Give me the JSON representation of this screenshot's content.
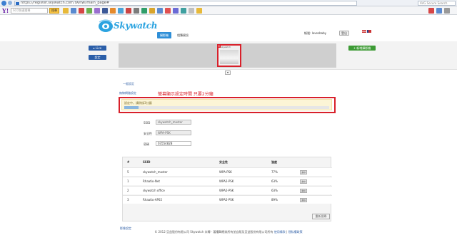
{
  "browser": {
    "url_prefix": "skywatch.com.tw",
    "url_full": "https://register.skywatch.com.tw/twi/main_page#",
    "search_placeholder": "AVG Secure Search"
  },
  "toolbar": {
    "search_placeholder": "SCO快速搜尋",
    "search_button": "搜尋"
  },
  "header": {
    "logo_text": "Skywatch",
    "tab_main": "攝影機",
    "tab_second": "相簿資訊",
    "account_label": "帳號: lovesbaby",
    "logout": "登出"
  },
  "camera": {
    "live_button": "▸ Live",
    "settings_button": "設定",
    "add_button": "+ 新增攝影機",
    "thumb_caption": "skywatch",
    "scroll_icon": "▾"
  },
  "settings": {
    "section_general": "一般設定",
    "section_wireless": "無線網路設定",
    "annotation": "螢幕顯示設定時間 只要2分鐘",
    "alert_text": "設定中，請稍候3分鐘",
    "alert_progress": 0.07,
    "ssid_label": "SSID",
    "ssid_value": "skywatch_master",
    "security_label": "安全性",
    "security_value": "WPA-PSK",
    "password_label": "密碼",
    "password_value": "03554828",
    "table_headers": [
      "#",
      "SSID",
      "安全性",
      "強度"
    ],
    "networks": [
      {
        "num": "5",
        "ssid": "skywatch_master",
        "security": "WPA-PSK",
        "strength": "77%",
        "action": "連線"
      },
      {
        "num": "1",
        "ssid": "Rhaatio-Net",
        "security": "WPA2-PSK",
        "strength": "63%",
        "action": "連線"
      },
      {
        "num": "2",
        "ssid": "skywatch office",
        "security": "WPA2-PSK",
        "strength": "63%",
        "action": "連線"
      },
      {
        "num": "3",
        "ssid": "Rhaatio-AP02",
        "security": "WPA2-PSK",
        "strength": "89%",
        "action": "連線"
      }
    ],
    "refresh_button": "重新搜尋",
    "section_other": "影像設定"
  },
  "footer": {
    "text": "© 2012 亞益股份有限公司 Skywatch 永轉 · 著權歸總其所有並自版及亞益股份有限公司所有",
    "link_terms": "使用條款",
    "link_privacy": "隱私權政策"
  },
  "colors": {
    "brand_blue": "#2ba3e0",
    "tab_blue": "#2f8fd8",
    "nav_blue": "#2b5ea8",
    "add_green": "#3d9b35",
    "annotation_red": "#d8202a"
  }
}
